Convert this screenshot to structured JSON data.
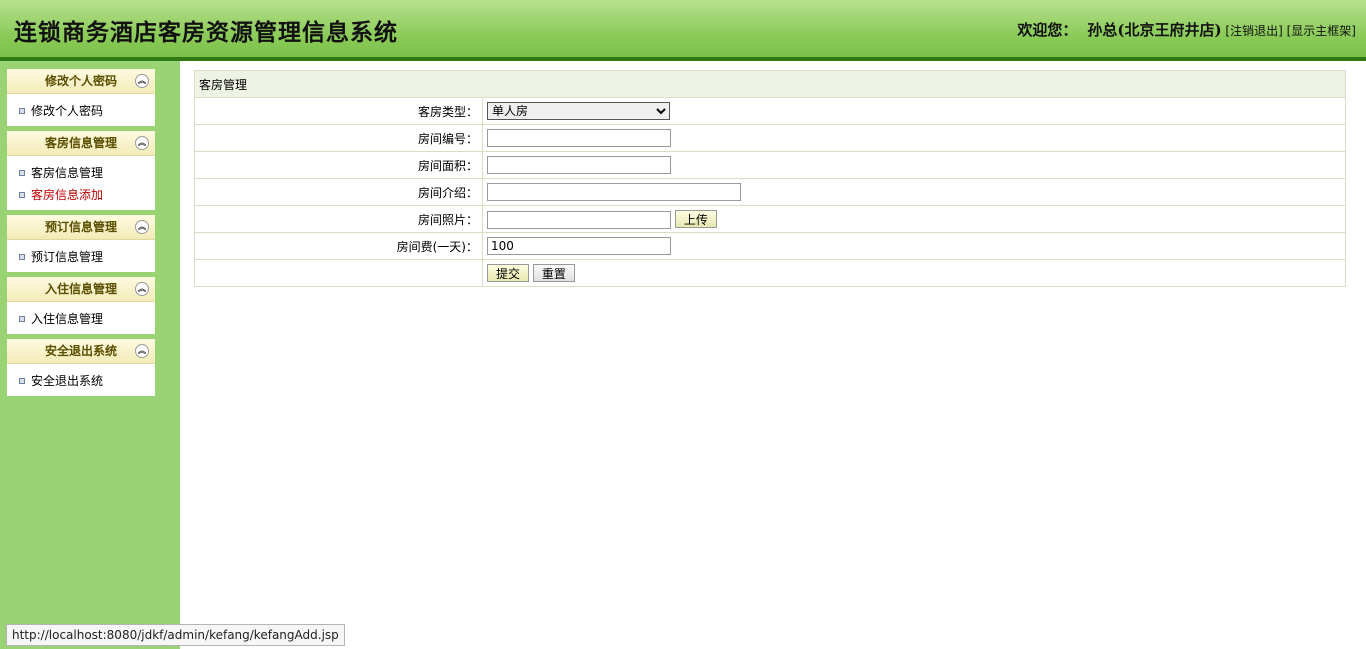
{
  "header": {
    "title": "连锁商务酒店客房资源管理信息系统",
    "welcome": "欢迎您：",
    "user": "孙总(北京王府井店)",
    "logout": "[注销退出]",
    "main_frame": "[显示主框架]"
  },
  "sidebar": {
    "panels": [
      {
        "title": "修改个人密码",
        "items": [
          "修改个人密码"
        ]
      },
      {
        "title": "客房信息管理",
        "items": [
          "客房信息管理",
          "客房信息添加"
        ]
      },
      {
        "title": "预订信息管理",
        "items": [
          "预订信息管理"
        ]
      },
      {
        "title": "入住信息管理",
        "items": [
          "入住信息管理"
        ]
      },
      {
        "title": "安全退出系统",
        "items": [
          "安全退出系统"
        ]
      }
    ],
    "active_item": "客房信息添加"
  },
  "form": {
    "caption": "客房管理",
    "room_type_label": "客房类型：",
    "room_type_value": "单人房",
    "room_no_label": "房间编号：",
    "area_label": "房间面积：",
    "intro_label": "房间介绍：",
    "photo_label": "房间照片：",
    "upload_button": "上传",
    "fee_label": "房间费(一天)：",
    "fee_value": "100",
    "submit_button": "提交",
    "reset_button": "重置"
  },
  "statusbar": {
    "url": "http://localhost:8080/jdkf/admin/kefang/kefangAdd.jsp"
  }
}
